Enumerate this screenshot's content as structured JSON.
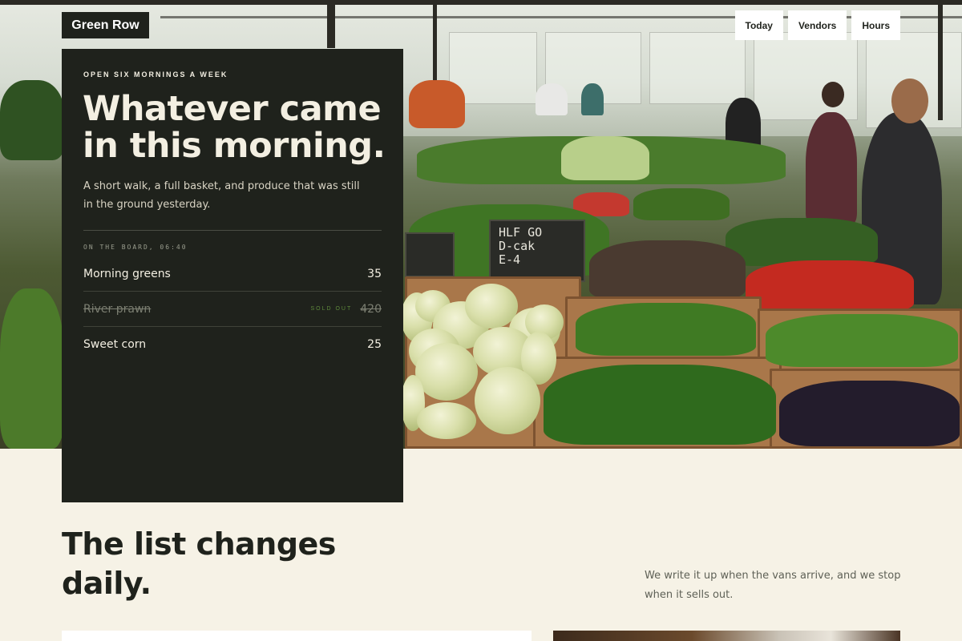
{
  "brand": {
    "name": "Green Row"
  },
  "nav": {
    "items": [
      "Today",
      "Vendors",
      "Hours"
    ]
  },
  "hero": {
    "kicker": "OPEN SIX MORNINGS A WEEK",
    "headline": "Whatever came in this morning.",
    "lede": "A short walk, a full basket, and produce that was still in the ground yesterday.",
    "board_label": "ON THE BOARD, 06:40",
    "board": [
      {
        "name": "Morning greens",
        "price": "35",
        "status": ""
      },
      {
        "name": "River prawn",
        "price": "420",
        "status": "SOLD OUT"
      },
      {
        "name": "Sweet corn",
        "price": "25",
        "status": ""
      }
    ],
    "chalk_sign": "HLF GO\nD-cak\nE-4"
  },
  "section": {
    "title": "The list changes daily.",
    "note": "We write it up when the vans arrive, and we stop when it sells out."
  }
}
